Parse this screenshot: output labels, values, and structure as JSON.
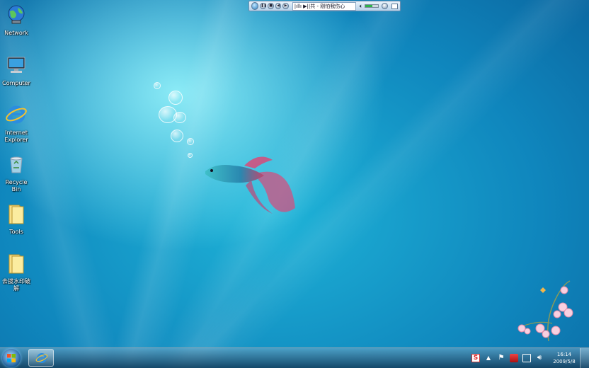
{
  "desktop": {
    "icons": [
      {
        "label": "Network"
      },
      {
        "label": "Computer"
      },
      {
        "label": "Internet Explorer"
      },
      {
        "label": "Recycle Bin"
      },
      {
        "label": "Tools"
      },
      {
        "label": "去拔水印破解"
      }
    ]
  },
  "media_player": {
    "now_playing": "|ıllı ▶||共 - 刚怕我伤心"
  },
  "taskbar": {
    "pinned": [
      {
        "icon": "internet-explorer-icon"
      }
    ],
    "tray": {
      "clock_time": "16:14",
      "clock_date": "2009/5/8",
      "ime_label": "S"
    }
  },
  "colors": {
    "accent": "#0f86bd",
    "taskbar": "#1c4c6e"
  }
}
